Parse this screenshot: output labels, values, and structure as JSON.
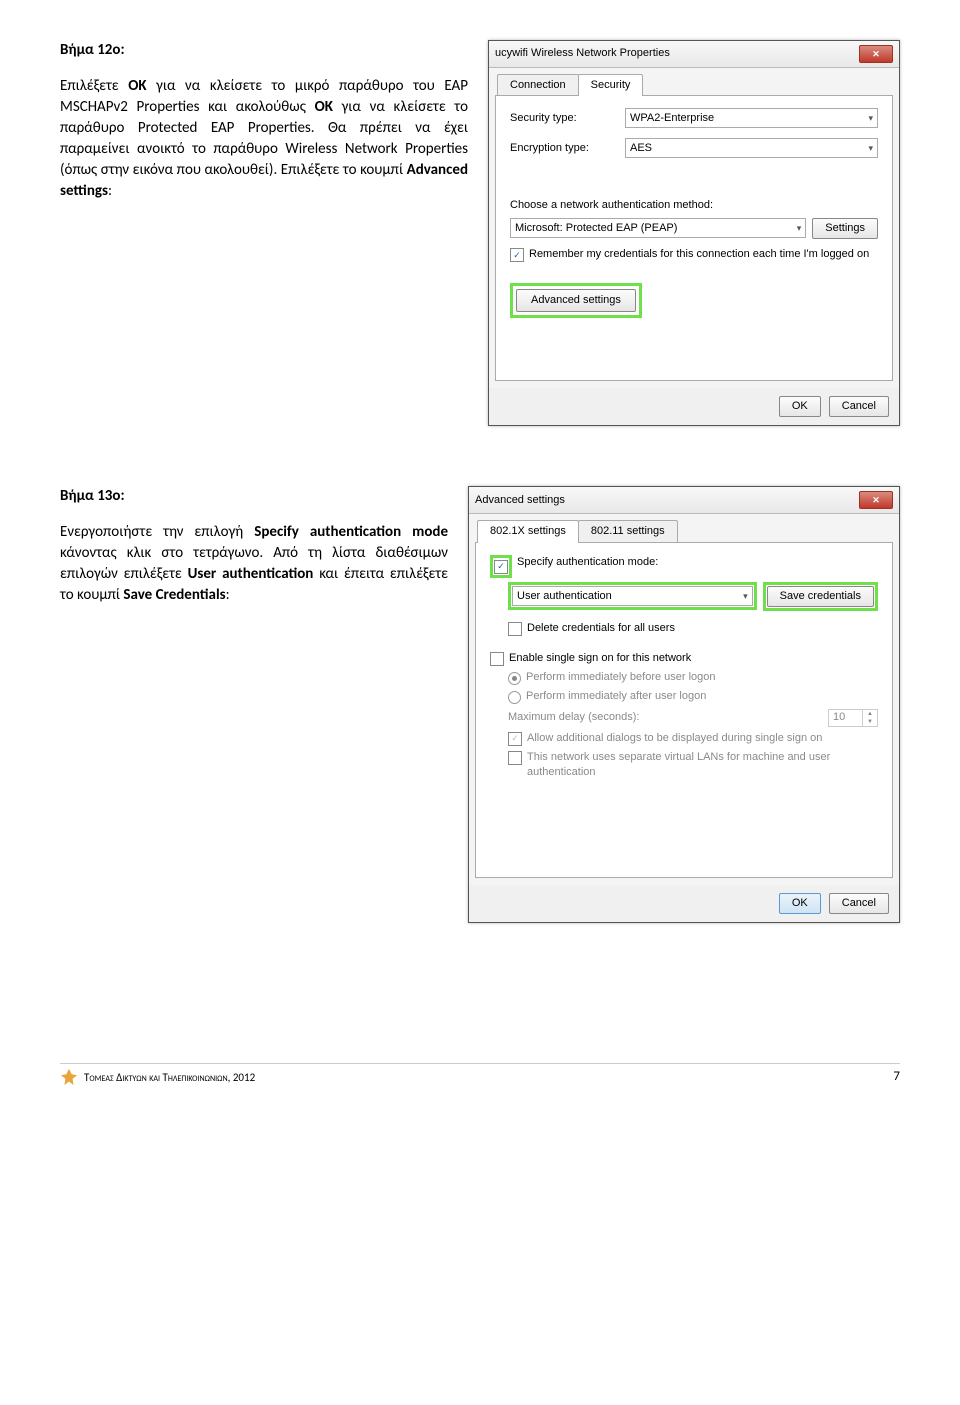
{
  "step12": {
    "title": "Βήμα 12ο:",
    "t1": "Επιλέξετε ",
    "t2": "ΟΚ",
    "t3": " για να κλείσετε το μικρό παράθυρο του EAP MSCHAPv2 Properties και ακολούθως ",
    "t4": "ΟΚ",
    "t5": " για να κλείσετε το παράθυρο Protected EAP Properties. Θα πρέπει να έχει παραμείνει ανοικτό το παράθυρο Wireless Network Properties (όπως στην εικόνα που ακολουθεί). Επιλέξετε το κουμπί ",
    "t6": "Advanced settings",
    "t7": ":"
  },
  "win1": {
    "title": "ucywifi Wireless Network Properties",
    "tab1": "Connection",
    "tab2": "Security",
    "sectype_lbl": "Security type:",
    "sectype_val": "WPA2-Enterprise",
    "enctype_lbl": "Encryption type:",
    "enctype_val": "AES",
    "auth_lbl": "Choose a network authentication method:",
    "auth_val": "Microsoft: Protected EAP (PEAP)",
    "settings_btn": "Settings",
    "remember": "Remember my credentials for this connection each time I'm logged on",
    "advanced": "Advanced settings",
    "ok": "OK",
    "cancel": "Cancel"
  },
  "step13": {
    "title": "Βήμα 13ο:",
    "t1": "Ενεργοποιήστε την επιλογή ",
    "t2": "Specify authentication mode",
    "t3": " κάνοντας κλικ στο τετράγωνο. Από τη λίστα διαθέσιμων επιλογών επιλέξετε ",
    "t4": "User authentication",
    "t5": " και έπειτα επιλέξετε το κουμπί ",
    "t6": "Save Credentials",
    "t7": ":"
  },
  "win2": {
    "title": "Advanced settings",
    "tab1": "802.1X settings",
    "tab2": "802.11 settings",
    "specify": "Specify authentication mode:",
    "mode": "User authentication",
    "savecred": "Save credentials",
    "delcred": "Delete credentials for all users",
    "sso": "Enable single sign on for this network",
    "before": "Perform immediately before user logon",
    "after": "Perform immediately after user logon",
    "maxdelay": "Maximum delay (seconds):",
    "maxdelay_val": "10",
    "allow": "Allow additional dialogs to be displayed during single sign on",
    "vlan": "This network uses separate virtual LANs for machine and user authentication",
    "ok": "OK",
    "cancel": "Cancel"
  },
  "footer": {
    "text": "Τομεας Δικτyων και Τηλεπικοινωνιων, 2012",
    "page": "7"
  }
}
